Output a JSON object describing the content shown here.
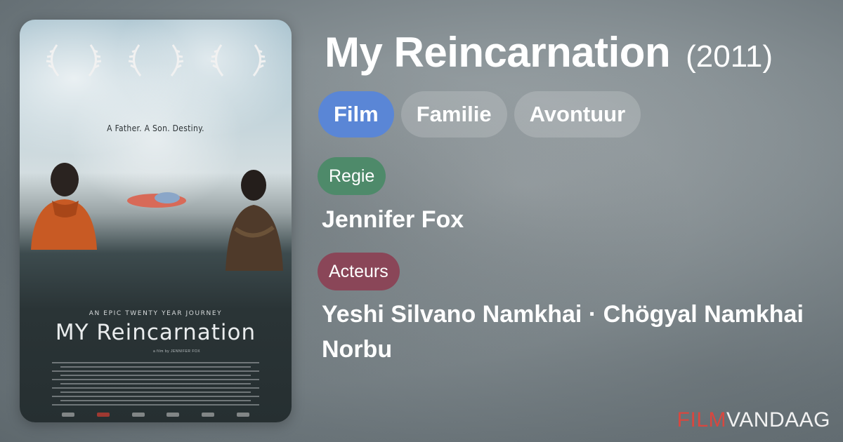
{
  "movie": {
    "title": "My Reincarnation",
    "year": "(2011)"
  },
  "genres": [
    {
      "label": "Film",
      "active": true
    },
    {
      "label": "Familie",
      "active": false
    },
    {
      "label": "Avontuur",
      "active": false
    }
  ],
  "credits": {
    "director_label": "Regie",
    "director": "Jennifer Fox",
    "actors_label": "Acteurs",
    "actors": "Yeshi Silvano Namkhai · Chögyal Namkhai Norbu"
  },
  "poster": {
    "tagline": "A Father. A Son. Destiny.",
    "subtitle": "AN EPIC TWENTY YEAR JOURNEY",
    "title": "MY Reincarnation",
    "credit": "a film by JENNIFER FOX"
  },
  "brand": {
    "part1": "FILM",
    "part2": "VANDAAG"
  },
  "colors": {
    "genre_active": "#5a86d6",
    "label_regie": "#4e8a6a",
    "label_acteurs": "#8a4658",
    "brand_accent": "#d9473f"
  }
}
